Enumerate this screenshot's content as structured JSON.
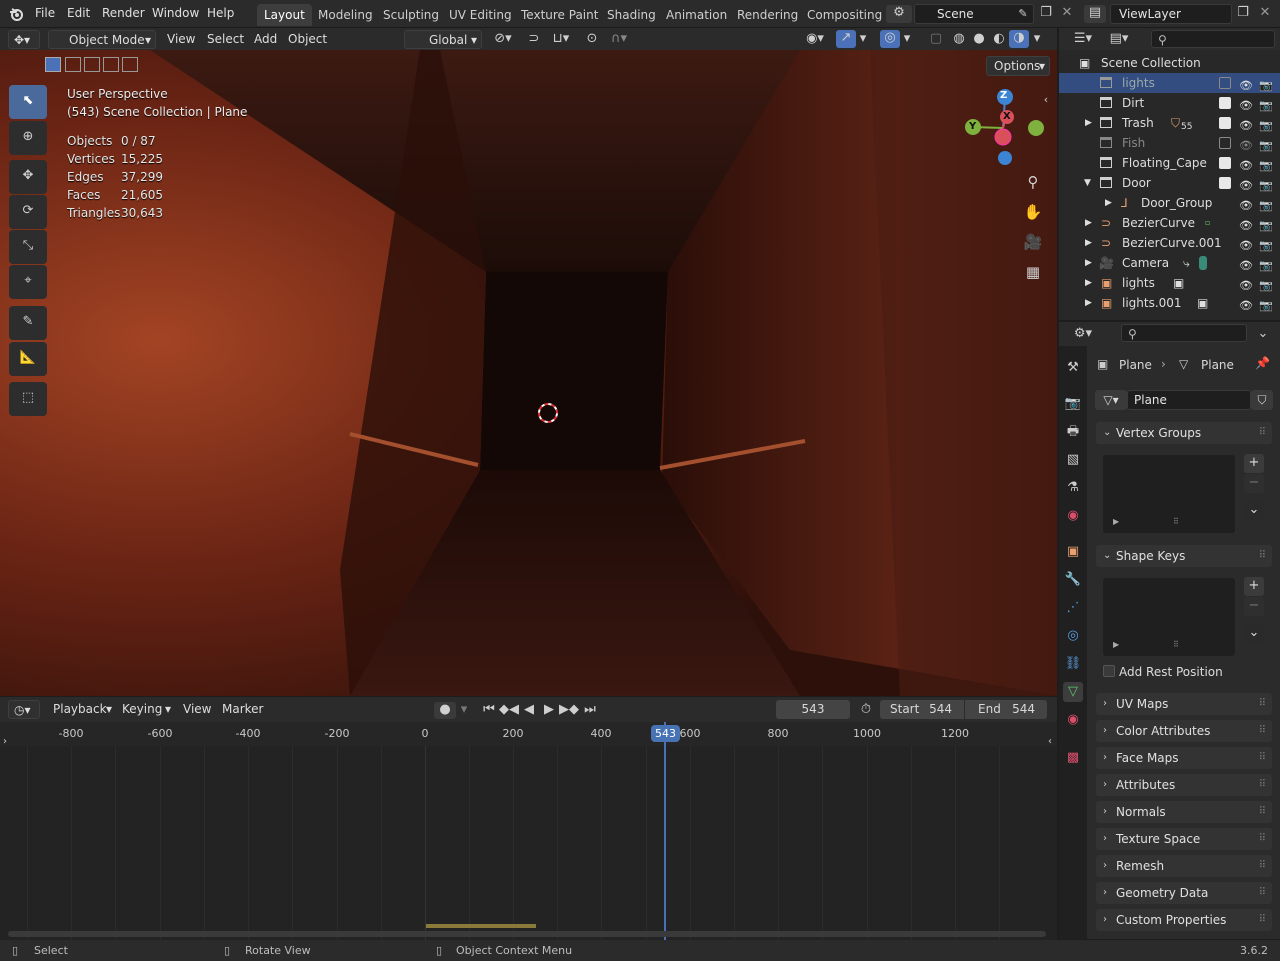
{
  "topbar": {
    "menus": [
      "File",
      "Edit",
      "Render",
      "Window",
      "Help"
    ],
    "workspaces": [
      "Layout",
      "Modeling",
      "Sculpting",
      "UV Editing",
      "Texture Paint",
      "Shading",
      "Animation",
      "Rendering",
      "Compositing"
    ],
    "active_workspace": "Layout",
    "scene": "Scene",
    "view_layer": "ViewLayer"
  },
  "viewport_header": {
    "mode": "Object Mode",
    "menus": [
      "View",
      "Select",
      "Add",
      "Object"
    ],
    "orientation": "Global",
    "options": "Options"
  },
  "viewport": {
    "perspective": "User Perspective",
    "context": "(543) Scene Collection | Plane",
    "stats": [
      {
        "k": "Objects",
        "v": "0 / 87"
      },
      {
        "k": "Vertices",
        "v": "15,225"
      },
      {
        "k": "Edges",
        "v": "37,299"
      },
      {
        "k": "Faces",
        "v": "21,605"
      },
      {
        "k": "Triangles",
        "v": "30,643"
      }
    ],
    "gizmo": {
      "x": "X",
      "y": "Y",
      "z": "Z"
    }
  },
  "outliner": {
    "root": "Scene Collection",
    "items": [
      {
        "label": "lights",
        "checked": false,
        "dim": true,
        "selected": true
      },
      {
        "label": "Dirt",
        "checked": true
      },
      {
        "label": "Trash",
        "checked": true,
        "badge": "55"
      },
      {
        "label": "Fish",
        "checked": false,
        "dim": true
      },
      {
        "label": "Floating_Cape",
        "checked": true
      },
      {
        "label": "Door",
        "checked": true
      },
      {
        "label": "Door_Group"
      },
      {
        "label": "BezierCurve"
      },
      {
        "label": "BezierCurve.001"
      },
      {
        "label": "Camera"
      },
      {
        "label": "lights"
      },
      {
        "label": "lights.001"
      }
    ]
  },
  "properties": {
    "breadcrumb_object": "Plane",
    "breadcrumb_data": "Plane",
    "data_name": "Plane",
    "vertex_groups": "Vertex Groups",
    "shape_keys": "Shape Keys",
    "add_rest_position": "Add Rest Position",
    "panels": [
      "UV Maps",
      "Color Attributes",
      "Face Maps",
      "Attributes",
      "Normals",
      "Texture Space",
      "Remesh",
      "Geometry Data",
      "Custom Properties"
    ]
  },
  "timeline": {
    "menus": [
      "Playback",
      "Keying",
      "View",
      "Marker"
    ],
    "current_frame": "543",
    "start_label": "Start",
    "start": "544",
    "end_label": "End",
    "end": "544",
    "ticks": [
      "-800",
      "-600",
      "-400",
      "-200",
      "0",
      "200",
      "400",
      "600",
      "800",
      "1000",
      "1200"
    ],
    "playhead": "543"
  },
  "status": {
    "select": "Select",
    "rotate": "Rotate View",
    "context_menu": "Object Context Menu",
    "version": "3.6.2"
  },
  "colors": {
    "accent": "#4b72b8",
    "selection": "#334d80",
    "playhead": "#4772b3",
    "x_axis": "#d9505a",
    "y_axis": "#7eb13d",
    "z_axis": "#3c84d4"
  }
}
